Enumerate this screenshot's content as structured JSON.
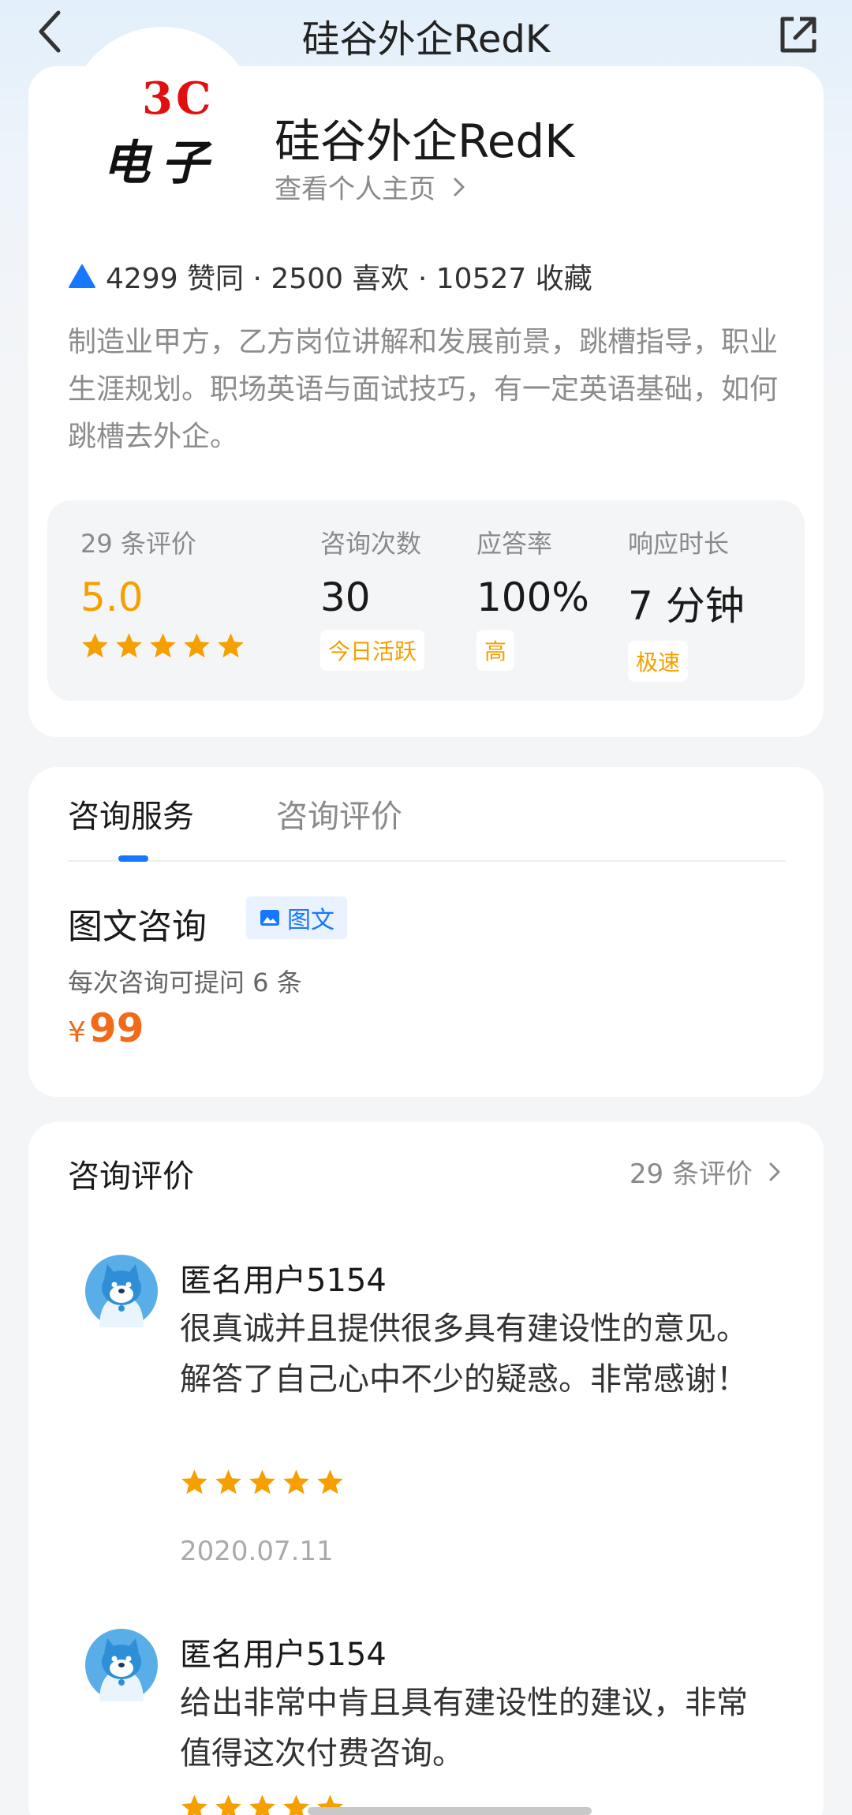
{
  "nav": {
    "title": "硅谷外企RedK"
  },
  "profile": {
    "logo_line1": "3C",
    "logo_line2": "电子",
    "name": "硅谷外企RedK",
    "view_profile": "查看个人主页",
    "stats": "4299 赞同 · 2500 喜欢 · 10527 收藏",
    "bio": "制造业甲方，乙方岗位讲解和发展前景，跳槽指导，职业生涯规划。职场英语与面试技巧，有一定英语基础，如何跳槽去外企。"
  },
  "metrics": {
    "reviews_label": "29 条评价",
    "rating": "5.0",
    "rating_stars": 5,
    "consult_label": "咨询次数",
    "consult_value": "30",
    "consult_tag": "今日活跃",
    "answer_label": "应答率",
    "answer_value": "100%",
    "answer_tag": "高",
    "response_label": "响应时长",
    "response_value": "7 分钟",
    "response_tag": "极速"
  },
  "services": {
    "tabs": [
      {
        "label": "咨询服务",
        "active": true
      },
      {
        "label": "咨询评价",
        "active": false
      }
    ],
    "title": "图文咨询",
    "badge": "图文",
    "subtitle": "每次咨询可提问 6 条",
    "currency": "¥",
    "price": "99"
  },
  "reviews": {
    "heading": "咨询评价",
    "count_link": "29 条评价",
    "items": [
      {
        "user": "匿名用户5154",
        "text": "很真诚并且提供很多具有建设性的意见。解答了自己心中不少的疑惑。非常感谢！",
        "stars": 5,
        "date": "2020.07.11"
      },
      {
        "user": "匿名用户5154",
        "text": "给出非常中肯且具有建设性的建议，非常值得这次付费咨询。",
        "stars": 5
      }
    ]
  },
  "colors": {
    "accent_blue": "#1677ff",
    "star_orange": "#f5a000",
    "price_orange": "#f06a1a",
    "logo_red": "#e01010"
  }
}
